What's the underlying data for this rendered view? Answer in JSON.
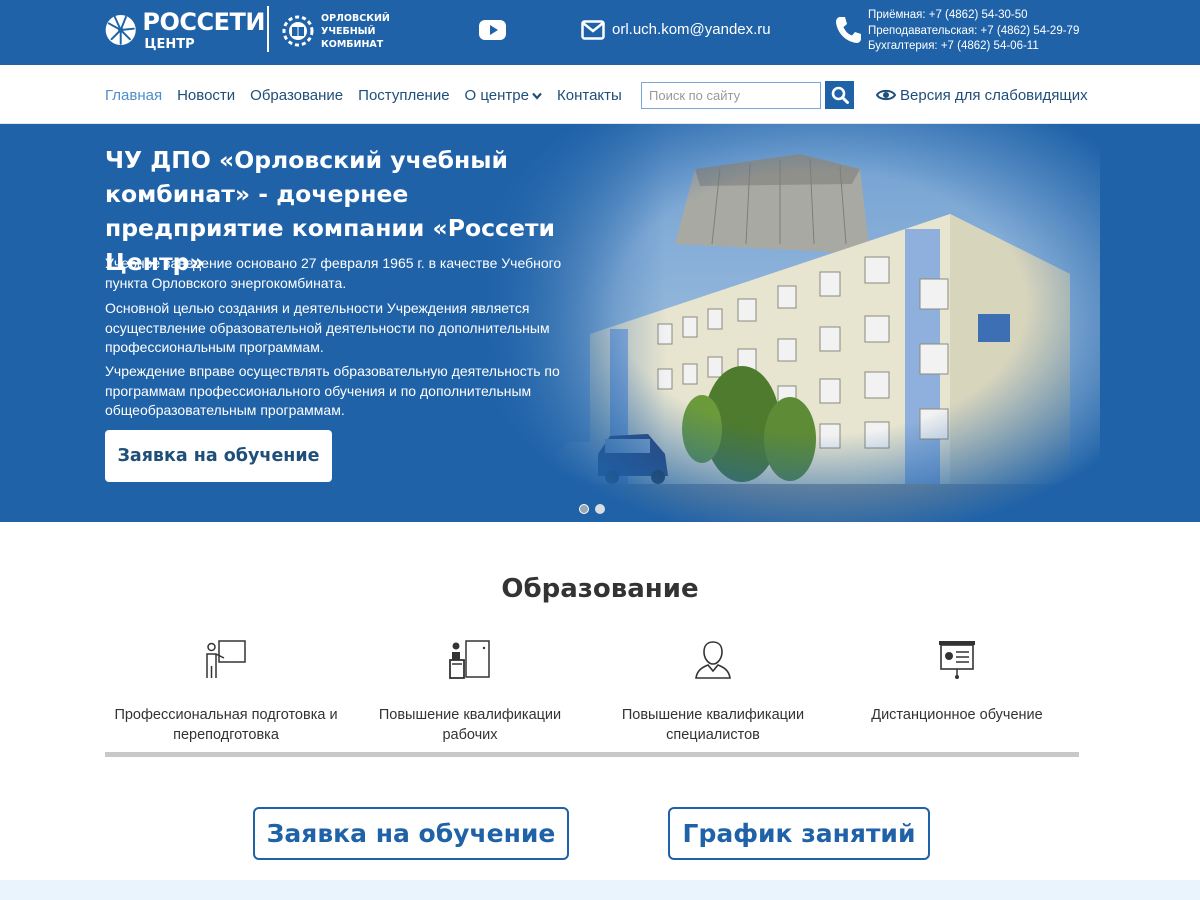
{
  "header": {
    "logo": {
      "brand": "РОССЕТИ",
      "brand_sub": "ЦЕНТР",
      "sub_line1": "ОРЛОВСКИЙ",
      "sub_line2": "УЧЕБНЫЙ",
      "sub_line3": "КОМБИНАТ"
    },
    "youtube_icon": "youtube-icon",
    "email": "orl.uch.kom@yandex.ru",
    "phones": [
      "Приёмная: +7 (4862) 54-30-50",
      "Преподавательская: +7 (4862) 54-29-79",
      "Бухгалтерия: +7 (4862) 54-06-11"
    ]
  },
  "nav": {
    "items": [
      {
        "label": "Главная",
        "active": true
      },
      {
        "label": "Новости"
      },
      {
        "label": "Образование"
      },
      {
        "label": "Поступление"
      },
      {
        "label": "О центре",
        "dropdown": true
      },
      {
        "label": "Контакты"
      }
    ],
    "search_placeholder": "Поиск по сайту",
    "low_vision": "Версия для слабовидящих"
  },
  "hero": {
    "title": "ЧУ ДПО «Орловский учебный комбинат» - дочернее предприятие компании «Россети Центр»",
    "p1": "Учебное заведение основано 27 февраля 1965 г. в качестве Учебного пункта Орловского энергокомбината.",
    "p2": "Основной целью создания и деятельности Учреждения является осуществление образовательной деятельности по дополнительным профессиональным программам.",
    "p3": "Учреждение вправе осуществлять образовательную деятельность по программам профессионального обучения и по дополнительным общеобразовательным программам.",
    "button": "Заявка на обучение",
    "slides": 2,
    "active_slide": 1
  },
  "education": {
    "title": "Образование",
    "items": [
      {
        "label": "Профессиональная подготовка и переподготовка",
        "icon": "teacher-board-icon"
      },
      {
        "label": "Повышение квалификации рабочих",
        "icon": "lectern-icon"
      },
      {
        "label": "Повышение квалификации специалистов",
        "icon": "person-icon"
      },
      {
        "label": "Дистанционное обучение",
        "icon": "presentation-screen-icon"
      }
    ]
  },
  "actions": {
    "apply": "Заявка на обучение",
    "schedule": "График занятий"
  },
  "colors": {
    "brand": "#1f62a8",
    "nav_text": "#1f4e79",
    "active": "#4f8ec9"
  }
}
